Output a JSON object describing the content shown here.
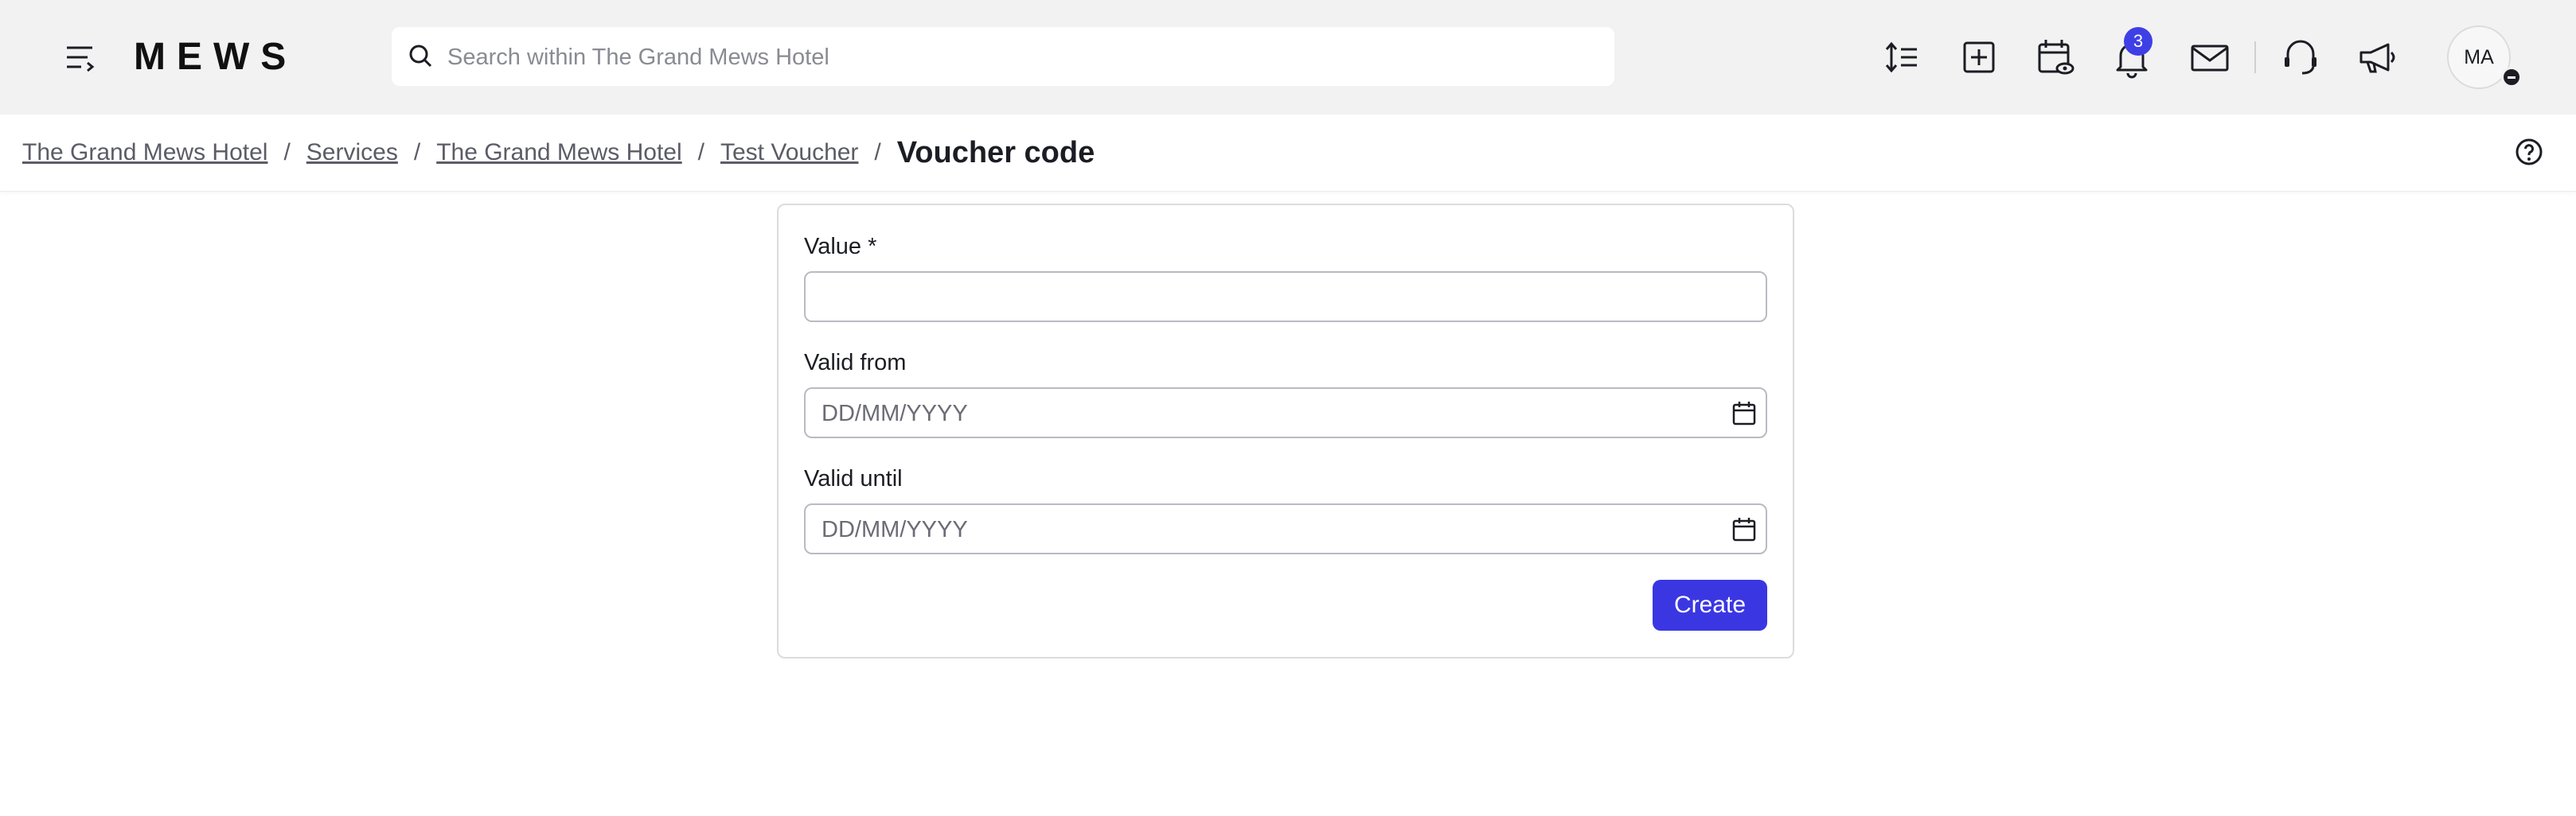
{
  "brand": {
    "logo_text": "MEWS"
  },
  "header": {
    "search": {
      "placeholder": "Search within The Grand Mews Hotel"
    },
    "notifications_count": "3",
    "user_initials": "MA"
  },
  "breadcrumb": {
    "items": [
      "The Grand Mews Hotel",
      "Services",
      "The Grand Mews Hotel",
      "Test Voucher"
    ],
    "separator": "/",
    "current": "Voucher code"
  },
  "form": {
    "value_label": "Value *",
    "value": "",
    "valid_from_label": "Valid from",
    "valid_from_placeholder": "DD/MM/YYYY",
    "valid_until_label": "Valid until",
    "valid_until_placeholder": "DD/MM/YYYY",
    "create_label": "Create"
  },
  "colors": {
    "accent": "#3a37e2",
    "header_bg": "#f2f2f2",
    "badge": "#3f3fe6"
  }
}
